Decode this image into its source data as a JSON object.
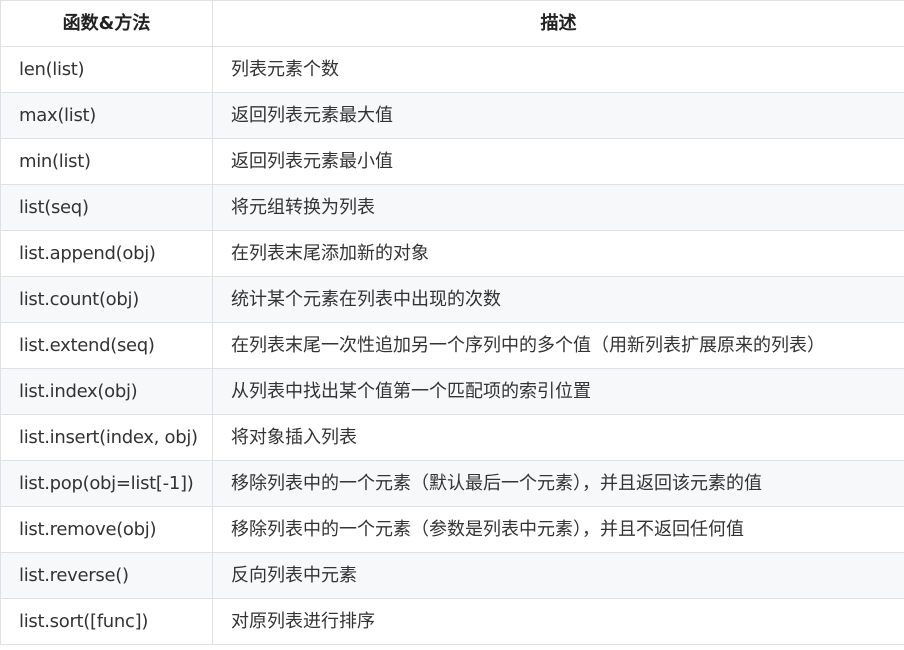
{
  "table": {
    "headers": [
      "函数&方法",
      "描述"
    ],
    "rows": [
      {
        "method": "len(list)",
        "description": "列表元素个数"
      },
      {
        "method": "max(list)",
        "description": "返回列表元素最大值"
      },
      {
        "method": "min(list)",
        "description": "返回列表元素最小值"
      },
      {
        "method": "list(seq)",
        "description": "将元组转换为列表"
      },
      {
        "method": "list.append(obj)",
        "description": "在列表末尾添加新的对象"
      },
      {
        "method": "list.count(obj)",
        "description": "统计某个元素在列表中出现的次数"
      },
      {
        "method": "list.extend(seq)",
        "description": "在列表末尾一次性追加另一个序列中的多个值（用新列表扩展原来的列表）"
      },
      {
        "method": "list.index(obj)",
        "description": "从列表中找出某个值第一个匹配项的索引位置"
      },
      {
        "method": "list.insert(index, obj)",
        "description": "将对象插入列表"
      },
      {
        "method": "list.pop(obj=list[-1])",
        "description": "移除列表中的一个元素（默认最后一个元素），并且返回该元素的值"
      },
      {
        "method": "list.remove(obj)",
        "description": "移除列表中的一个元素（参数是列表中元素），并且不返回任何值"
      },
      {
        "method": "list.reverse()",
        "description": "反向列表中元素"
      },
      {
        "method": "list.sort([func])",
        "description": "对原列表进行排序"
      }
    ]
  }
}
